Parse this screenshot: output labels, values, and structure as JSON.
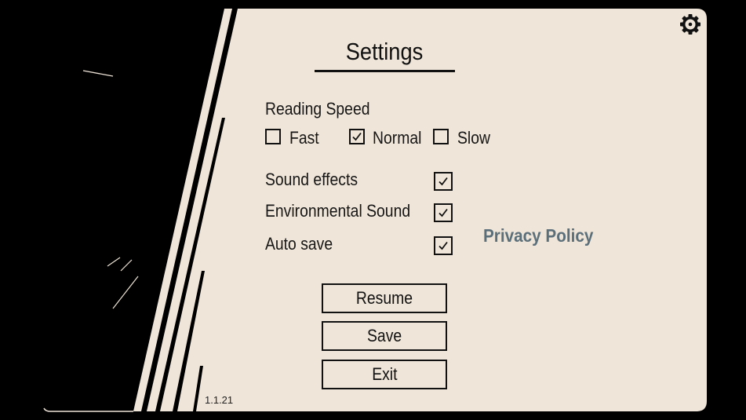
{
  "colors": {
    "panel": "#EFE5D8",
    "ink": "#111111",
    "privacy_link": "#5B6F7A"
  },
  "header": {
    "title": "Settings",
    "settings_icon": "gear-icon"
  },
  "reading_speed": {
    "label": "Reading Speed",
    "options": [
      {
        "label": "Fast",
        "checked": false
      },
      {
        "label": "Normal",
        "checked": true
      },
      {
        "label": "Slow",
        "checked": false
      }
    ]
  },
  "toggles": [
    {
      "label": "Sound effects",
      "checked": true
    },
    {
      "label": "Environmental Sound",
      "checked": true
    },
    {
      "label": "Auto save",
      "checked": true
    }
  ],
  "privacy_policy": "Privacy Policy",
  "buttons": {
    "resume": "Resume",
    "save": "Save",
    "exit": "Exit"
  },
  "version": "1.1.21"
}
